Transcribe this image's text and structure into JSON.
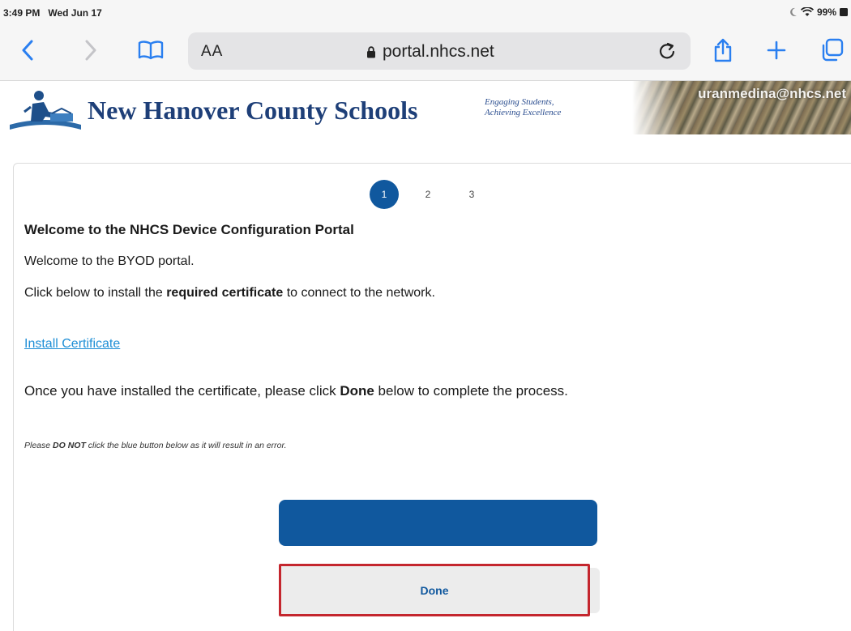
{
  "status_bar": {
    "time": "3:49 PM",
    "date": "Wed Jun 17",
    "battery": "99%"
  },
  "browser": {
    "aa_label": "AA",
    "url": "portal.nhcs.net"
  },
  "site_header": {
    "school_name": "New Hanover County Schools",
    "tagline_line1": "Engaging Students,",
    "tagline_line2": "Achieving Excellence",
    "email": "uranmedina@nhcs.net"
  },
  "steps": [
    {
      "label": "1",
      "active": true
    },
    {
      "label": "2",
      "active": false
    },
    {
      "label": "3",
      "active": false
    }
  ],
  "content": {
    "title": "Welcome to the NHCS Device Configuration Portal",
    "welcome_text": "Welcome to the BYOD portal.",
    "instruction_pre": "Click below to install the ",
    "instruction_bold": "required certificate",
    "instruction_post": " to connect to the network.",
    "install_link": "Install Certificate",
    "done_pre": "Once you have installed the certificate, please click ",
    "done_bold": "Done",
    "done_post": " below to complete the process.",
    "note_pre": "Please ",
    "note_bold": "DO NOT",
    "note_post": " click the blue button below as it will result in an error."
  },
  "buttons": {
    "blue_button_label": "",
    "done_label": "Done"
  },
  "colors": {
    "brand_blue": "#10589e",
    "link_blue": "#1f8fd6",
    "highlight_red": "#c4262e",
    "school_navy": "#1e3f78"
  }
}
